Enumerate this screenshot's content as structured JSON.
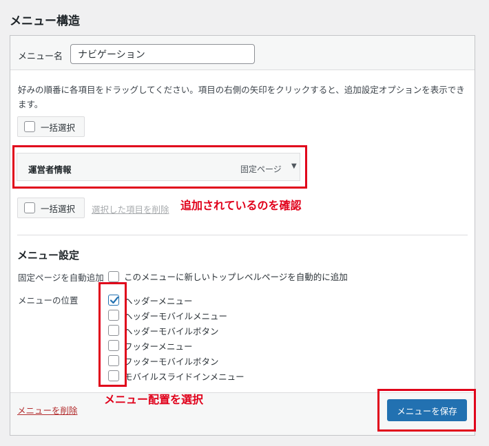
{
  "page": {
    "title": "メニュー構造"
  },
  "menu_name": {
    "label": "メニュー名",
    "value": "ナビゲーション"
  },
  "instructions": "好みの順番に各項目をドラッグしてください。項目の右側の矢印をクリックすると、追加設定オプションを表示できます。",
  "bulk_select_label": "一括選択",
  "menu_item": {
    "title": "運営者情報",
    "type": "固定ページ",
    "arrow_icon": "triangle-down-icon"
  },
  "remove_selected": "選択した項目を削除",
  "settings": {
    "title": "メニュー設定",
    "auto_add_label": "固定ページを自動追加",
    "auto_add_option": "このメニューに新しいトップレベルページを自動的に追加",
    "location_label": "メニューの位置",
    "locations": [
      {
        "label": "ヘッダーメニュー",
        "checked": true
      },
      {
        "label": "ヘッダーモバイルメニュー",
        "checked": false
      },
      {
        "label": "ヘッダーモバイルボタン",
        "checked": false
      },
      {
        "label": "フッターメニュー",
        "checked": false
      },
      {
        "label": "フッターモバイルボタン",
        "checked": false
      },
      {
        "label": "モバイルスライドインメニュー",
        "checked": false
      }
    ]
  },
  "footer": {
    "delete_label": "メニューを削除",
    "save_label": "メニューを保存"
  },
  "annotations": {
    "added_confirm": "追加されているのを確認",
    "select_location": "メニュー配置を選択"
  },
  "colors": {
    "accent": "#2271b1",
    "annotation": "#e0001a",
    "delete": "#b32d2e"
  }
}
